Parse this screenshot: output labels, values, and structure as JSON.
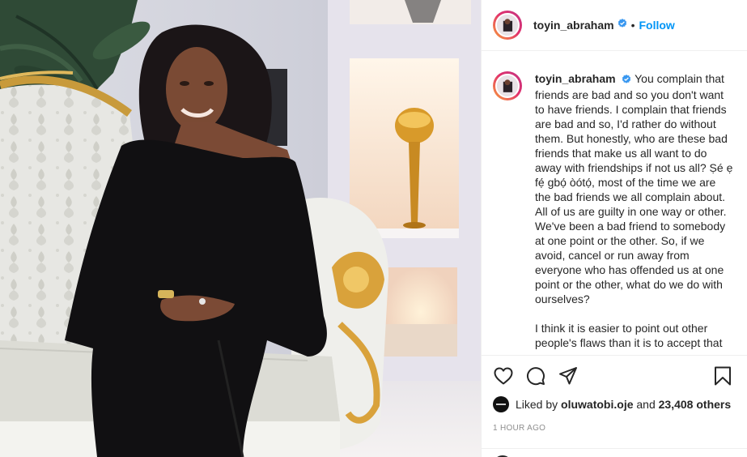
{
  "post": {
    "username": "toyin_abraham",
    "follow_label": "Follow",
    "separator": "•",
    "caption_paragraph_1": "You complain that friends are bad and so you don't want to have friends. I complain that friends are bad and so, I'd rather do without them. But honestly, who are these bad friends that make us all want to do away with friendships if not us all? Ṣé ẹ fẹ́ gbọ́ òótọ́, most of the time we are the bad friends we all complain about. All of us are guilty in one way or other. We've been a bad friend to somebody at one point or the other. So, if we avoid, cancel or run away from everyone who has offended us at one point or the other, what do we do with ourselves?",
    "caption_paragraph_2": "I think it is easier to point out other people's flaws than it is to accept that",
    "liked_by_prefix": "Liked by",
    "liked_by_user": "oluwatobi.oje",
    "liked_by_and": "and",
    "likes_others": "23,408 others",
    "timestamp": "1 HOUR AGO"
  },
  "icons": [
    "verified-badge-icon",
    "heart-icon",
    "comment-icon",
    "share-icon",
    "bookmark-icon"
  ],
  "colors": {
    "accent": "#0095f6",
    "text": "#262626",
    "muted": "#8e8e8e",
    "border": "#efefef"
  }
}
